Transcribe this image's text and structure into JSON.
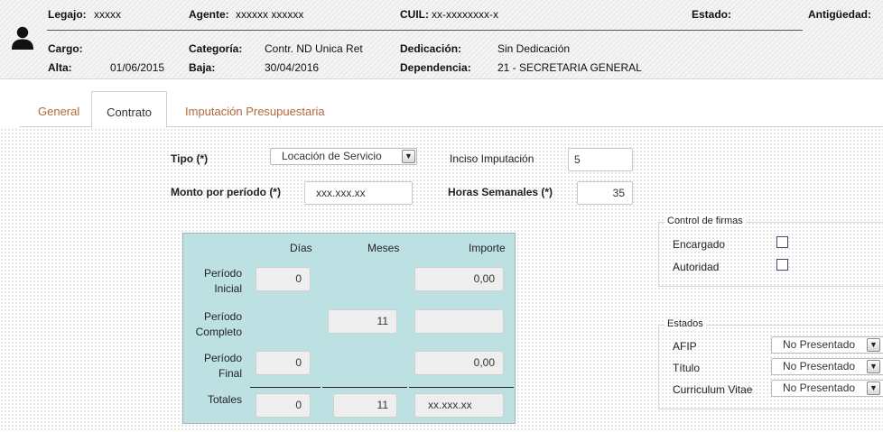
{
  "header": {
    "legajo_label": "Legajo:",
    "legajo_value": "xxxxx",
    "agente_label": "Agente:",
    "agente_value": "xxxxxx xxxxxx",
    "cuil_label": "CUIL:",
    "cuil_value": "xx-xxxxxxxx-x",
    "estado_label": "Estado:",
    "antiguedad_label": "Antigüedad:",
    "cargo_label": "Cargo:",
    "categoria_label": "Categoría:",
    "categoria_value": "Contr. ND Unica Ret",
    "dedicacion_label": "Dedicación:",
    "dedicacion_value": "Sin Dedicación",
    "alta_label": "Alta:",
    "alta_value": "01/06/2015",
    "baja_label": "Baja:",
    "baja_value": "30/04/2016",
    "dependencia_label": "Dependencia:",
    "dependencia_value": "21 - SECRETARIA GENERAL",
    "user_icon": "user-icon"
  },
  "tabs": [
    {
      "label": "General",
      "active": false
    },
    {
      "label": "Contrato",
      "active": true
    },
    {
      "label": "Imputación Presupuestaria",
      "active": false
    }
  ],
  "form": {
    "tipo_label": "Tipo (*)",
    "tipo_value": "Locación de Servicio",
    "inciso_label": "Inciso Imputación",
    "inciso_value": "5",
    "monto_label": "Monto por período (*)",
    "monto_value": "xxx.xxx.xx",
    "horas_label": "Horas Semanales (*)",
    "horas_value": "35"
  },
  "periods": {
    "col_dias": "Días",
    "col_meses": "Meses",
    "col_importe": "Importe",
    "inicial_line1": "Período",
    "inicial_line2": "Inicial",
    "inicial_dias": "0",
    "inicial_importe": "0,00",
    "completo_line1": "Período",
    "completo_line2": "Completo",
    "completo_meses": "11",
    "completo_importe": "",
    "final_line1": "Período",
    "final_line2": "Final",
    "final_dias": "0",
    "final_importe": "0,00",
    "totales_label": "Totales",
    "totales_dias": "0",
    "totales_meses": "11",
    "totales_importe": "xx.xxx.xx"
  },
  "control_firmas": {
    "legend": "Control de firmas",
    "encargado_label": "Encargado",
    "encargado_checked": false,
    "autoridad_label": "Autoridad",
    "autoridad_checked": false
  },
  "estados": {
    "legend": "Estados",
    "afip_label": "AFIP",
    "afip_value": "No Presentado",
    "titulo_label": "Título",
    "titulo_value": "No Presentado",
    "cv_label": "Curriculum Vitae",
    "cv_value": "No Presentado"
  }
}
